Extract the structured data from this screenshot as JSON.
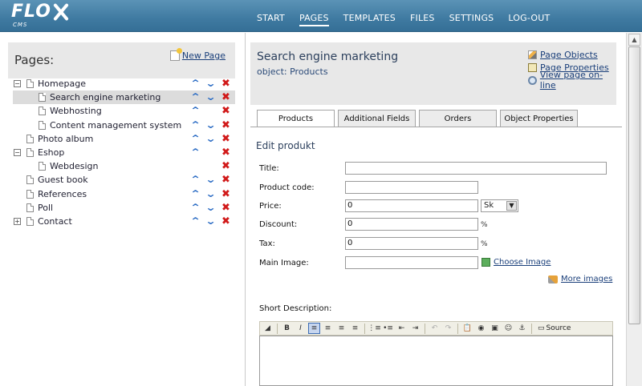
{
  "app": {
    "logo_text": "FLO",
    "logo_sub": "CMS"
  },
  "nav": {
    "items": [
      "START",
      "PAGES",
      "TEMPLATES",
      "FILES",
      "SETTINGS",
      "LOG-OUT"
    ],
    "active": "PAGES"
  },
  "left": {
    "title": "Pages:",
    "new_page": "New Page",
    "tree": [
      {
        "label": "Homepage",
        "expander": "−",
        "level": 0,
        "up": true,
        "down": true,
        "del": true
      },
      {
        "label": "Search engine marketing",
        "level": 1,
        "selected": true,
        "up": true,
        "down": true,
        "del": true
      },
      {
        "label": "Webhosting",
        "level": 1,
        "up": true,
        "down": false,
        "del": true
      },
      {
        "label": "Content management system",
        "level": 1,
        "up": true,
        "down": true,
        "del": true
      },
      {
        "label": "Photo album",
        "level": 0,
        "up": true,
        "down": true,
        "del": true
      },
      {
        "label": "Eshop",
        "expander": "−",
        "level": 0,
        "up": true,
        "down": false,
        "del": true
      },
      {
        "label": "Webdesign",
        "level": 1,
        "up": false,
        "down": false,
        "del": true
      },
      {
        "label": "Guest book",
        "level": 0,
        "up": true,
        "down": true,
        "del": true
      },
      {
        "label": "References",
        "level": 0,
        "up": true,
        "down": true,
        "del": true
      },
      {
        "label": "Poll",
        "level": 0,
        "up": true,
        "down": true,
        "del": true
      },
      {
        "label": "Contact",
        "expander": "+",
        "level": 0,
        "up": true,
        "down": true,
        "del": true
      }
    ]
  },
  "right": {
    "page_name": "Search engine marketing",
    "object_name": "object: Products",
    "links": {
      "page_objects": "Page Objects",
      "page_properties": "Page Properties",
      "view_online": "View page on-line"
    },
    "tabs": [
      "Products",
      "Additional Fields",
      "Orders",
      "Object Properties"
    ],
    "active_tab": "Products",
    "section_title": "Edit produkt",
    "form": {
      "title_label": "Title:",
      "title_value": "",
      "code_label": "Product code:",
      "code_value": "",
      "price_label": "Price:",
      "price_value": "0",
      "currency": "Sk",
      "discount_label": "Discount:",
      "discount_value": "0",
      "discount_suffix": "%",
      "tax_label": "Tax:",
      "tax_value": "0",
      "tax_suffix": "%",
      "image_label": "Main Image:",
      "image_value": "",
      "choose_image": "Choose Image",
      "more_images": "More images",
      "short_desc_label": "Short Description:",
      "source_label": "Source"
    }
  }
}
